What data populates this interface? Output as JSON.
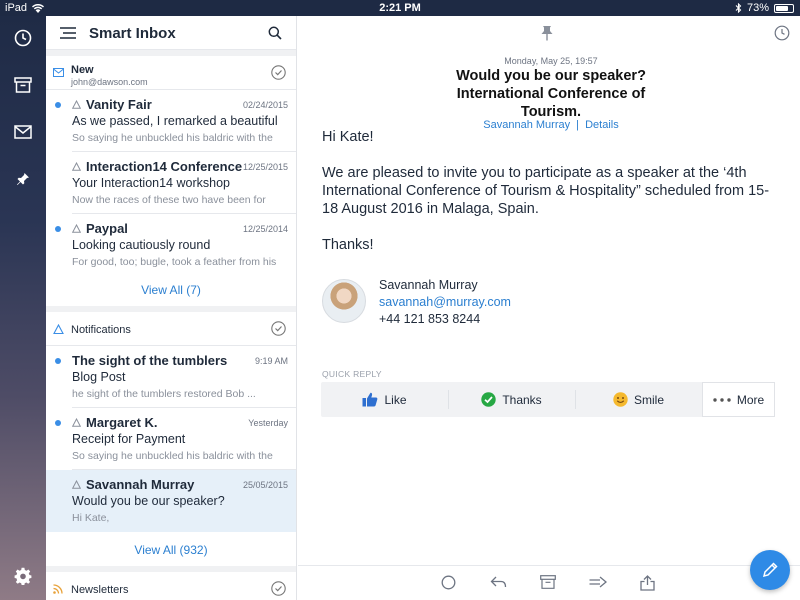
{
  "status_bar": {
    "device": "iPad",
    "time": "2:21 PM",
    "battery": "73%",
    "battery_level": 0.73
  },
  "rail": {
    "icons": [
      "clock-icon",
      "archive-icon",
      "mail-icon",
      "pin-icon",
      "settings-icon"
    ]
  },
  "list": {
    "title": "Smart Inbox",
    "sections": [
      {
        "name": "New",
        "subtitle": "john@dawson.com",
        "items": [
          {
            "sender": "Vanity Fair",
            "date": "02/24/2015",
            "subject": "As we passed, I remarked a beautiful",
            "preview": "So saying he unbuckled his baldric with the",
            "unread": true
          },
          {
            "sender": "Interaction14 Conference",
            "date": "12/25/2015",
            "subject": "Your Interaction14 workshop",
            "preview": "Now the races of these two have been for",
            "unread": false
          },
          {
            "sender": "Paypal",
            "date": "12/25/2014",
            "subject": "Looking cautiously round",
            "preview": "For good, too; bugle, took a feather from his",
            "unread": true
          }
        ],
        "view_all": "View All (7)"
      },
      {
        "name": "Notifications",
        "items": [
          {
            "sender": "The sight of the tumblers",
            "date": "9:19 AM",
            "subject": "Blog Post",
            "preview": "he sight of the tumblers restored Bob ...",
            "unread": true
          },
          {
            "sender": "Margaret K.",
            "date": "Yesterday",
            "subject": "Receipt for Payment",
            "preview": "So saying he unbuckled his baldric with the",
            "unread": true
          },
          {
            "sender": "Savannah Murray",
            "date": "25/05/2015",
            "subject": "Would you be our speaker?",
            "preview": "Hi Kate,",
            "unread": false,
            "selected": true
          }
        ],
        "view_all": "View All (932)"
      },
      {
        "name": "Newsletters"
      }
    ]
  },
  "reader": {
    "date": "Monday, May 25, 19:57",
    "title": "Would you be our speaker? International Conference of Tourism.",
    "from_name": "Savannah Murray",
    "separator": "|",
    "details_link": "Details",
    "greeting": "Hi Kate!",
    "paragraph": "We are pleased to invite you to participate as a speaker at the ‘4th International Conference of Tourism & Hospitality” scheduled from 15-18 August 2016 in Malaga, Spain.",
    "closing": "Thanks!",
    "signature": {
      "name": "Savannah Murray",
      "email": "savannah@murray.com",
      "phone": "+44 121 853 8244"
    },
    "quick_reply": {
      "label": "QUICK REPLY",
      "buttons": [
        {
          "label": "Like",
          "icon": "thumbs-up-icon"
        },
        {
          "label": "Thanks",
          "icon": "check-circle-icon"
        },
        {
          "label": "Smile",
          "icon": "smile-icon"
        },
        {
          "label": "More",
          "icon": "more-icon"
        }
      ]
    },
    "bottom_bar": [
      "circle-icon",
      "reply-icon",
      "archive-icon",
      "forward-icon",
      "share-icon"
    ]
  },
  "colors": {
    "accent": "#2e8ae6",
    "rail_top": "#1f2b46",
    "rail_bottom": "#8f7b86",
    "selected_row": "#e6f0f9"
  }
}
